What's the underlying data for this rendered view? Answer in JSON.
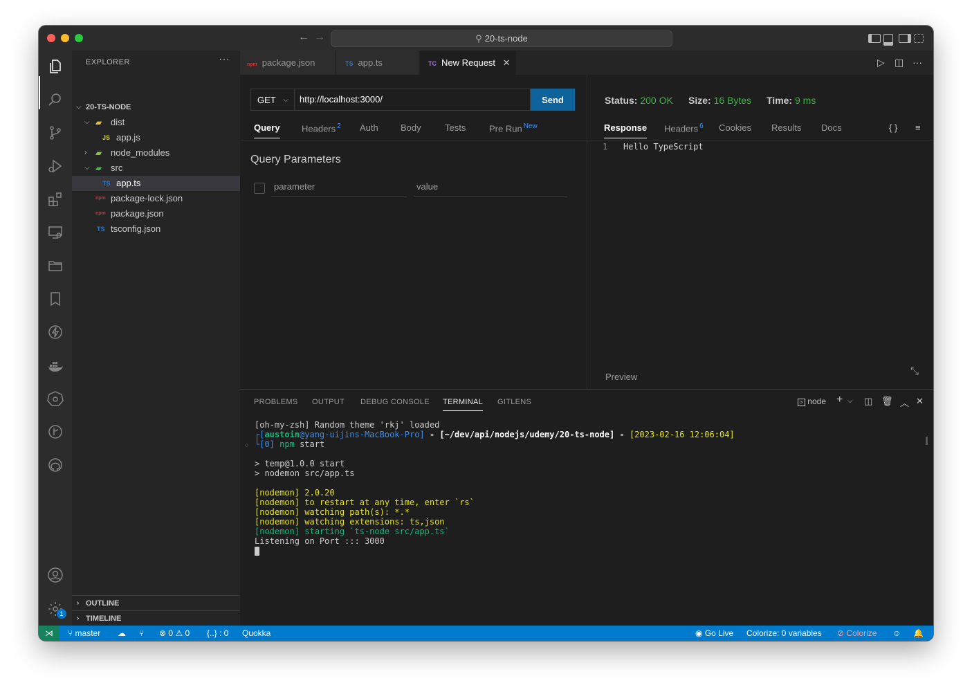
{
  "window": {
    "title": "20-ts-node"
  },
  "sidebar": {
    "title": "EXPLORER",
    "root": "20-TS-NODE",
    "tree": [
      {
        "label": "dist",
        "type": "folder",
        "icon": "folder-dist-icon"
      },
      {
        "label": "app.js",
        "type": "file",
        "icon_text": "JS"
      },
      {
        "label": "node_modules",
        "type": "folder",
        "icon": "folder-node-icon"
      },
      {
        "label": "src",
        "type": "folder",
        "icon": "folder-src-icon"
      },
      {
        "label": "app.ts",
        "type": "file",
        "icon_text": "TS"
      },
      {
        "label": "package-lock.json",
        "type": "file",
        "icon": "npm-icon"
      },
      {
        "label": "package.json",
        "type": "file",
        "icon": "npm-icon"
      },
      {
        "label": "tsconfig.json",
        "type": "file",
        "icon_text": "TS"
      }
    ],
    "outline": "OUTLINE",
    "timeline": "TIMELINE"
  },
  "tabs": [
    {
      "label": "package.json",
      "icon": "npm-icon"
    },
    {
      "label": "app.ts",
      "icon_text": "TS"
    },
    {
      "label": "New Request",
      "icon_text": "TC",
      "active": true
    }
  ],
  "request": {
    "method": "GET",
    "url": "http://localhost:3000/",
    "send": "Send",
    "tabs": [
      "Query",
      "Headers",
      "Auth",
      "Body",
      "Tests",
      "Pre Run"
    ],
    "headers_count": "2",
    "prerun_badge": "New",
    "query_title": "Query Parameters",
    "param_placeholder": "parameter",
    "value_placeholder": "value"
  },
  "response": {
    "status_label": "Status:",
    "status_value": "200 OK",
    "size_label": "Size:",
    "size_value": "16 Bytes",
    "time_label": "Time:",
    "time_value": "9 ms",
    "tabs": [
      "Response",
      "Headers",
      "Cookies",
      "Results",
      "Docs"
    ],
    "headers_count": "6",
    "format_icon": "{ }",
    "line_number": "1",
    "body": "Hello TypeScript",
    "preview": "Preview"
  },
  "panel": {
    "tabs": [
      "PROBLEMS",
      "OUTPUT",
      "DEBUG CONSOLE",
      "TERMINAL",
      "GITLENS"
    ],
    "shell": "node",
    "terminal": {
      "line1": "[oh-my-zsh] Random theme 'rkj' loaded",
      "user": "austoin",
      "host": "@yang-uijins-MacBook-Pro]",
      "path": "[~/dev/api/nodejs/udemy/20-ts-node]",
      "datetime": "[2023-02-16 12:06:04]",
      "prompt_num": "[0]",
      "cmd_npm": "npm",
      "cmd_rest": " start",
      "l_start": "> temp@1.0.0 start",
      "l_nodemon": "> nodemon src/app.ts",
      "n1": "[nodemon] 2.0.20",
      "n2": "[nodemon] to restart at any time, enter `rs`",
      "n3": "[nodemon] watching path(s): *.*",
      "n4": "[nodemon] watching extensions: ts,json",
      "n5": "[nodemon] starting `ts-node src/app.ts`",
      "listen": "Listening on Port ::: 3000"
    }
  },
  "statusbar": {
    "branch": "master",
    "errors": "0",
    "warnings": "0",
    "braces": "{..} : 0",
    "quokka": "Quokka",
    "golive": "Go Live",
    "colorize_vars": "Colorize: 0 variables",
    "colorize": "Colorize",
    "settings_badge": "1"
  },
  "colors": {
    "accent": "#007acc",
    "send": "#0e639c",
    "ok": "#3cb443",
    "remote": "#16825d"
  }
}
